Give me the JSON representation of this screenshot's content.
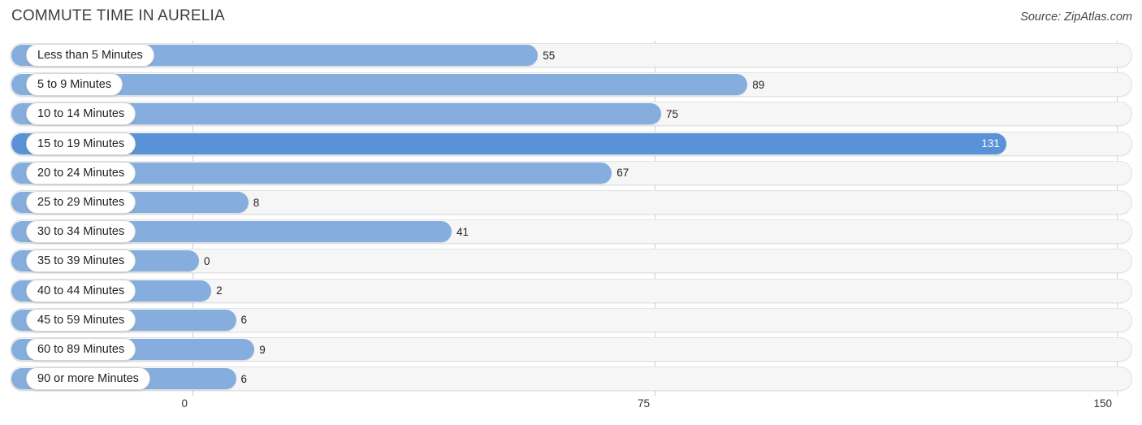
{
  "header": {
    "title": "COMMUTE TIME IN AURELIA",
    "source": "Source: ZipAtlas.com"
  },
  "chart_data": {
    "type": "bar",
    "orientation": "horizontal",
    "title": "COMMUTE TIME IN AURELIA",
    "subtitle": "",
    "xlabel": "",
    "ylabel": "",
    "xlim": [
      0,
      150
    ],
    "grid": true,
    "legend": null,
    "xticks": [
      "0",
      "75",
      "150"
    ],
    "xtick_values": [
      0,
      75,
      150
    ],
    "categories": [
      "Less than 5 Minutes",
      "5 to 9 Minutes",
      "10 to 14 Minutes",
      "15 to 19 Minutes",
      "20 to 24 Minutes",
      "25 to 29 Minutes",
      "30 to 34 Minutes",
      "35 to 39 Minutes",
      "40 to 44 Minutes",
      "45 to 59 Minutes",
      "60 to 89 Minutes",
      "90 or more Minutes"
    ],
    "values": [
      55,
      89,
      75,
      131,
      67,
      8,
      41,
      0,
      2,
      6,
      9,
      6
    ],
    "value_labels": [
      "55",
      "89",
      "75",
      "131",
      "67",
      "8",
      "41",
      "0",
      "2",
      "6",
      "9",
      "6"
    ],
    "highlight_index": 3,
    "colors": {
      "bar": "#85aede",
      "bar_highlight": "#5a92d8",
      "track": "#f6f6f6",
      "track_border": "#e2e2e2",
      "gridline": "#cfcfcf",
      "label_pill": "#ffffff",
      "text": "#222222"
    }
  }
}
